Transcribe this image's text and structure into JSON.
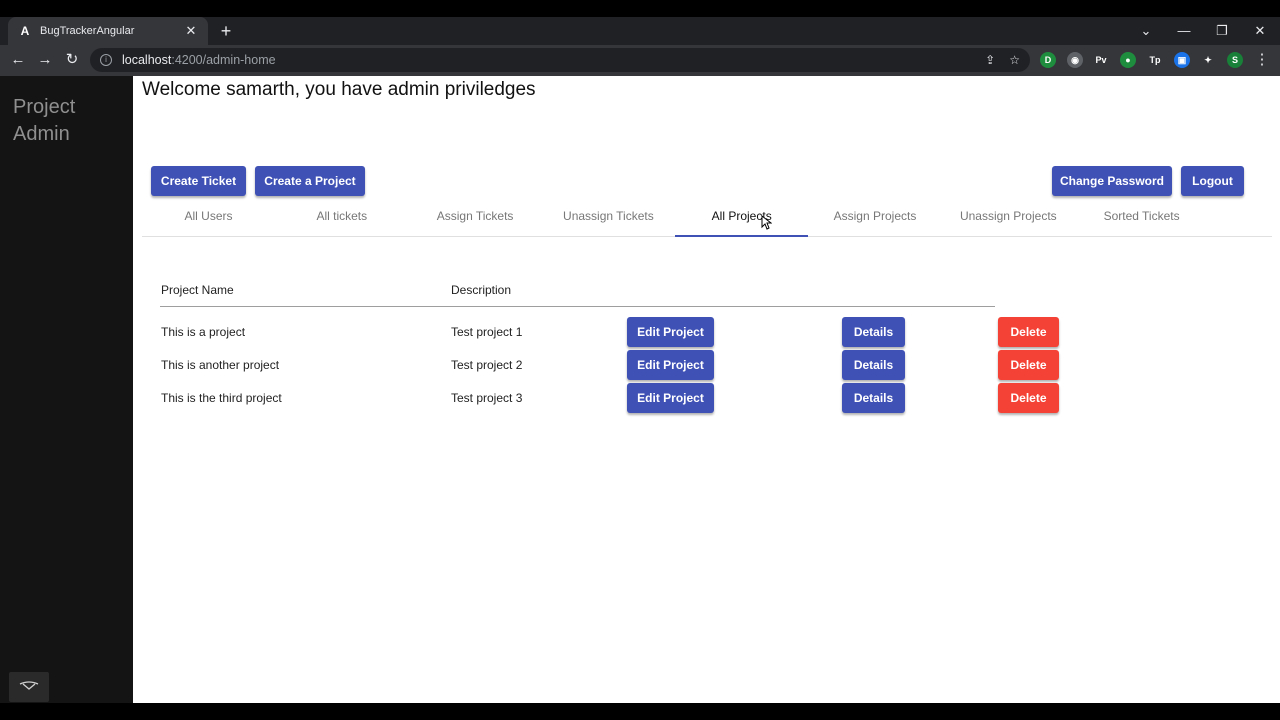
{
  "browser": {
    "tab_title": "BugTrackerAngular",
    "url_host": "localhost",
    "url_path": ":4200/admin-home",
    "extensions": [
      {
        "label": "D",
        "color": "#1e8e3e"
      },
      {
        "label": "◉",
        "color": "#5f6368"
      },
      {
        "label": "Pv",
        "color": "#35363a"
      },
      {
        "label": "●",
        "color": "#1e8e3e"
      },
      {
        "label": "Tp",
        "color": "#35363a"
      },
      {
        "label": "▣",
        "color": "#1a73e8"
      },
      {
        "label": "✦",
        "color": "#35363a"
      },
      {
        "label": "S",
        "color": "#188038"
      }
    ]
  },
  "sidebar": {
    "title": "Project Admin"
  },
  "header": {
    "welcome": "Welcome samarth, you have admin priviledges"
  },
  "actions": {
    "create_ticket": "Create Ticket",
    "create_project": "Create a Project",
    "change_password": "Change Password",
    "logout": "Logout"
  },
  "tabs": [
    {
      "label": "All Users"
    },
    {
      "label": "All tickets"
    },
    {
      "label": "Assign Tickets"
    },
    {
      "label": "Unassign Tickets"
    },
    {
      "label": "All Projects",
      "active": true
    },
    {
      "label": "Assign Projects"
    },
    {
      "label": "Unassign Projects"
    },
    {
      "label": "Sorted Tickets"
    }
  ],
  "table": {
    "columns": [
      "Project Name",
      "Description"
    ],
    "rows": [
      {
        "name": "This is a project",
        "description": "Test project 1"
      },
      {
        "name": "This is another project",
        "description": "Test project 2"
      },
      {
        "name": "This is the third project",
        "description": "Test project 3"
      }
    ],
    "edit_label": "Edit Project",
    "details_label": "Details",
    "delete_label": "Delete"
  },
  "colors": {
    "primary": "#3f51b5",
    "warn": "#f44336",
    "sidebar_bg": "#141414"
  }
}
